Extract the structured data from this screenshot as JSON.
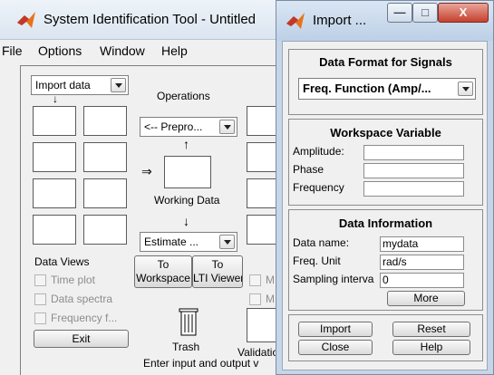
{
  "main_window": {
    "title": "System Identification Tool - Untitled",
    "menu": [
      "File",
      "Options",
      "Window",
      "Help"
    ],
    "import_data_select": "Import data",
    "operations_label": "Operations",
    "preprocess_select": "<-- Prepro...",
    "working_data_label": "Working Data",
    "estimate_select": "Estimate ...",
    "data_views_label": "Data Views",
    "to_workspace": [
      "To",
      "Workspace"
    ],
    "to_lti_viewer": [
      "To",
      "LTI Viewer"
    ],
    "data_views": [
      {
        "label": "Time plot",
        "checked": false
      },
      {
        "label": "Data spectra",
        "checked": false
      },
      {
        "label": "Frequency f...",
        "checked": false
      }
    ],
    "model_view_prefix": "M",
    "exit_label": "Exit",
    "trash_label": "Trash",
    "validation_label": "Validatio",
    "status_text": "Enter input and output v"
  },
  "import_dialog": {
    "title": "Import ...",
    "window_buttons": {
      "minimize": "—",
      "maximize": "□",
      "close": "X"
    },
    "data_format": {
      "header": "Data Format for Signals",
      "selected": "Freq. Function (Amp/..."
    },
    "workspace_variable": {
      "header": "Workspace Variable",
      "fields": [
        {
          "label": "Amplitude:",
          "value": ""
        },
        {
          "label": "Phase",
          "value": ""
        },
        {
          "label": "Frequency",
          "value": ""
        }
      ]
    },
    "data_information": {
      "header": "Data Information",
      "fields": [
        {
          "label": "Data name:",
          "value": "mydata"
        },
        {
          "label": "Freq. Unit",
          "value": "rad/s"
        },
        {
          "label": "Sampling interva",
          "value": "0"
        }
      ],
      "more_label": "More"
    },
    "buttons": {
      "import": "Import",
      "reset": "Reset",
      "close": "Close",
      "help": "Help"
    }
  },
  "colors": {
    "matlab_orange": "#e8731c",
    "matlab_red": "#c0392b",
    "close_red": "#c5412e"
  }
}
